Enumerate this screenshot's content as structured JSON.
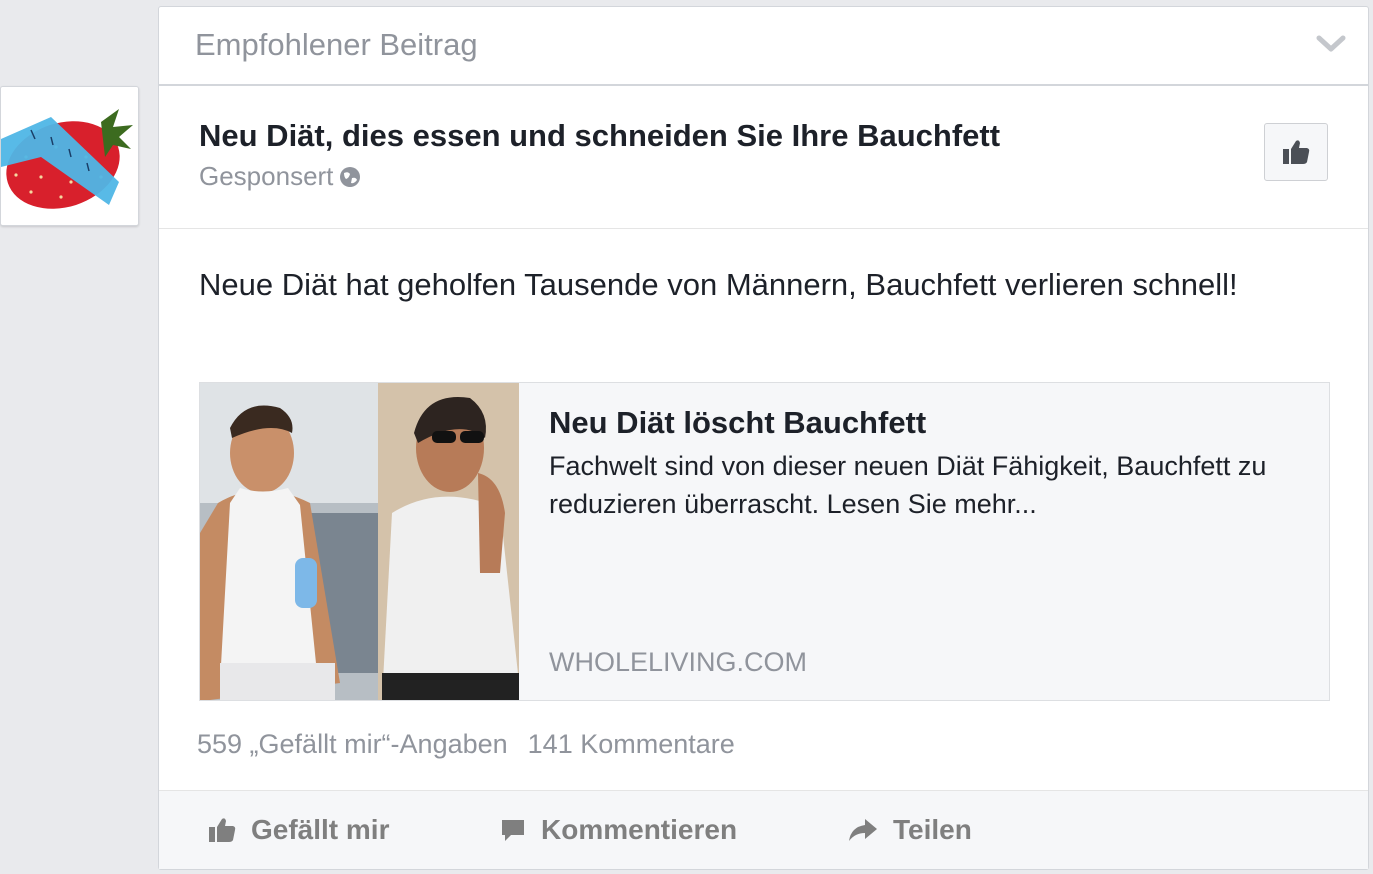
{
  "header": {
    "title": "Empfohlener Beitrag",
    "chevron_icon": "chevron-down-icon"
  },
  "post": {
    "title": "Neu Diät, dies essen und schneiden Sie Ihre Bauchfett",
    "sponsored": "Gesponsert",
    "privacy_icon": "globe-icon",
    "like_page_icon": "thumbs-up-icon",
    "text": "Neue Diät hat geholfen Tausende von Männern, Bauchfett verlieren schnell!"
  },
  "link": {
    "title": "Neu Diät löscht Bauchfett",
    "description": "Fachwelt sind von dieser neuen Diät Fähigkeit, Bauchfett zu reduzieren überrascht. Lesen Sie mehr...",
    "domain": "WHOLELIVING.COM"
  },
  "stats": {
    "likes": "559 „Gefällt mir“-Angaben",
    "comments": "141 Kommentare"
  },
  "actions": {
    "like": "Gefällt mir",
    "comment": "Kommentieren",
    "share": "Teilen"
  },
  "colors": {
    "background": "#e9eaed",
    "muted_text": "#90949c",
    "primary_text": "#1d2129",
    "action_text": "#7f7f7f"
  }
}
